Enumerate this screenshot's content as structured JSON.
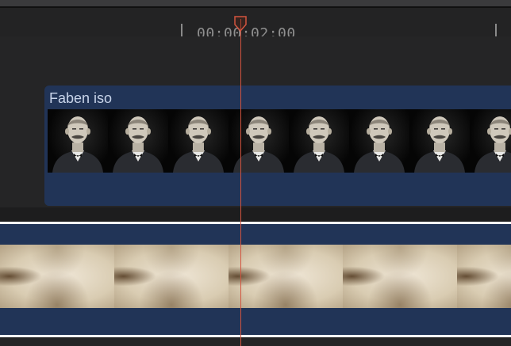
{
  "ruler": {
    "timecode": "00:00:02;00"
  },
  "primary_clip": {
    "title": "Faben iso",
    "thumbnail_count": 8
  },
  "background_clip": {
    "texture_count": 5
  },
  "colors": {
    "clip_fill": "#213457",
    "playhead": "#d3543f",
    "selection_border": "#ffffff"
  }
}
